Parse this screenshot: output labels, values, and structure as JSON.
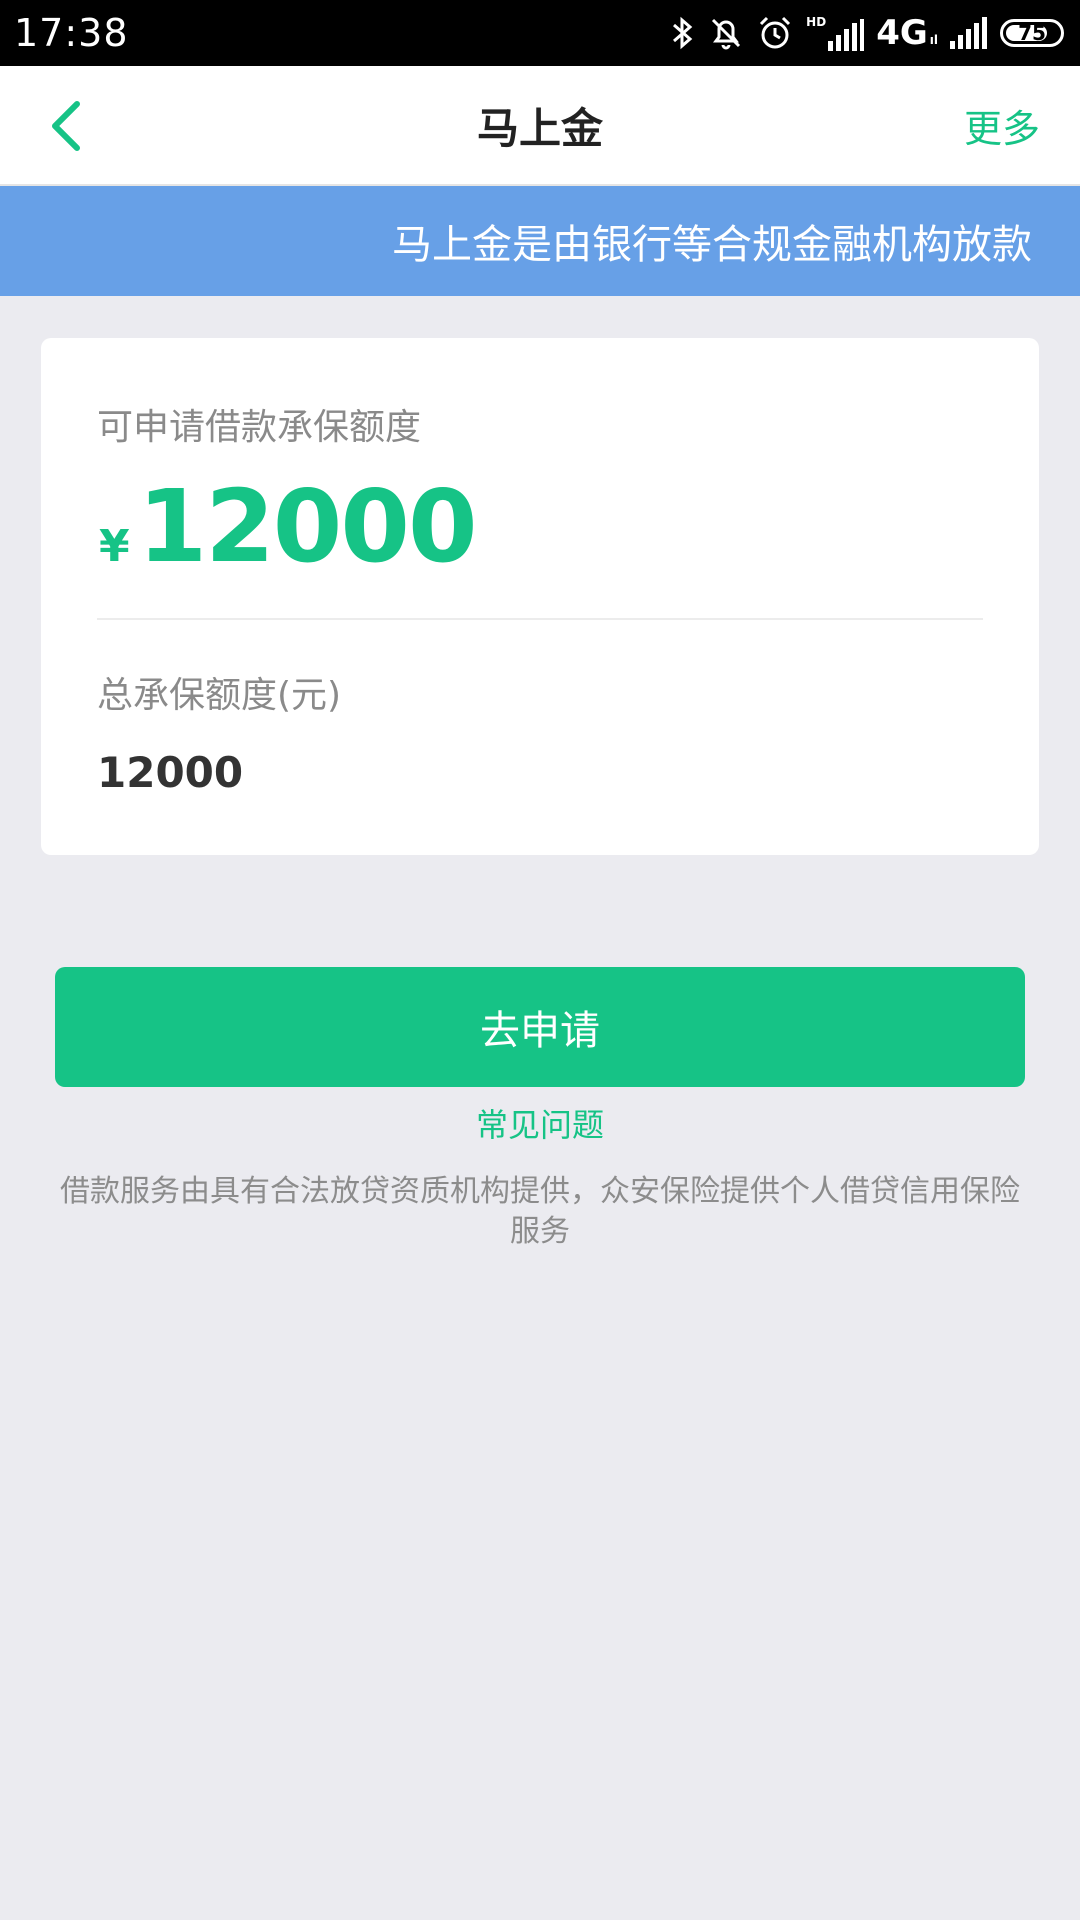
{
  "status_bar": {
    "time": "17:38",
    "network_label": "4G",
    "network_sub": "ıl",
    "hd_label": "HD",
    "battery_level": "75"
  },
  "nav": {
    "title": "马上金",
    "more_label": "更多"
  },
  "notice": {
    "text": "马上金是由银行等合规金融机构放款"
  },
  "card": {
    "available_label": "可申请借款承保额度",
    "currency_symbol": "¥",
    "available_amount": "12000",
    "total_label": "总承保额度(元)",
    "total_amount": "12000"
  },
  "actions": {
    "apply_label": "去申请",
    "faq_label": "常见问题"
  },
  "disclaimer": "借款服务由具有合法放贷资质机构提供，众安保险提供个人借贷信用保险服务",
  "colors": {
    "accent": "#16c386",
    "notice_bg": "#67a0e7",
    "page_bg": "#ebebf0"
  }
}
